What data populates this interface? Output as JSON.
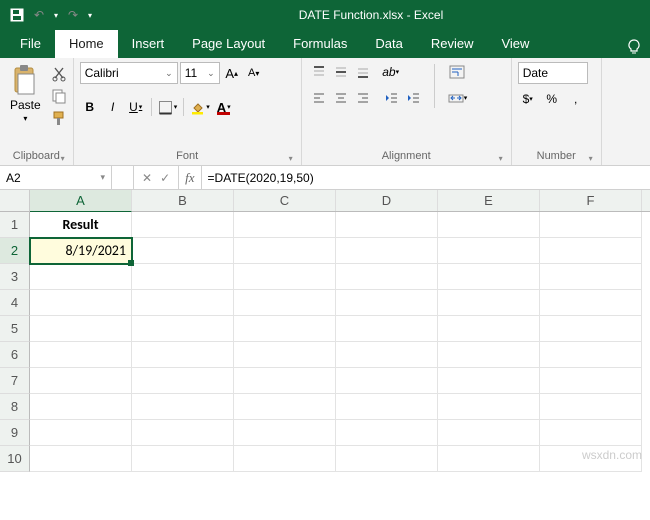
{
  "app": {
    "title": "DATE Function.xlsx - Excel"
  },
  "qat": {
    "save": "💾",
    "undo": "↶",
    "redo": "↷"
  },
  "tabs": [
    "File",
    "Home",
    "Insert",
    "Page Layout",
    "Formulas",
    "Data",
    "Review",
    "View"
  ],
  "active_tab": "Home",
  "ribbon": {
    "clipboard": {
      "label": "Clipboard",
      "paste": "Paste"
    },
    "font": {
      "label": "Font",
      "family": "Calibri",
      "size": "11",
      "grow": "A▴",
      "shrink": "A▾",
      "bold": "B",
      "italic": "I",
      "underline": "U"
    },
    "alignment": {
      "label": "Alignment",
      "wrap": "Wrap",
      "merge": "Merge"
    },
    "number": {
      "label": "Number",
      "format": "Date",
      "currency": "$",
      "percent": "%",
      "comma": ","
    }
  },
  "namebox": "A2",
  "formula": "=DATE(2020,19,50)",
  "fx": "fx",
  "columns": [
    "A",
    "B",
    "C",
    "D",
    "E",
    "F"
  ],
  "rows": [
    "1",
    "2",
    "3",
    "4",
    "5",
    "6",
    "7",
    "8",
    "9",
    "10"
  ],
  "cells": {
    "A1": "Result",
    "A2": "8/19/2021"
  },
  "watermark": "wsxdn.com",
  "chart_data": {
    "type": "table",
    "columns": [
      "Result"
    ],
    "data": [
      [
        "8/19/2021"
      ]
    ],
    "formula_bar": "=DATE(2020,19,50)",
    "active_cell": "A2"
  }
}
